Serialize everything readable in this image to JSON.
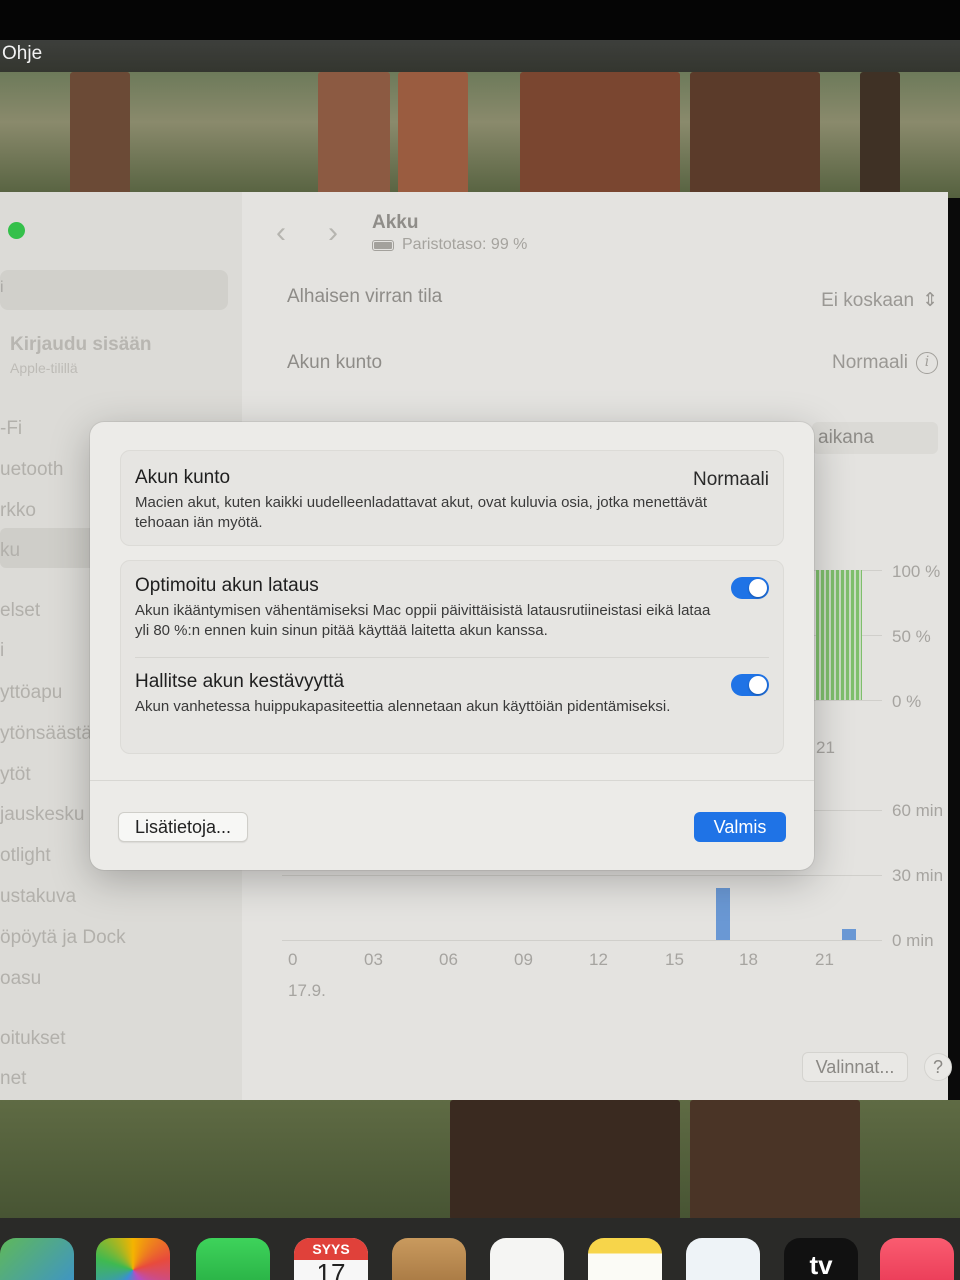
{
  "menubar": {
    "item": "Ohje"
  },
  "sidebar": {
    "search_partial": "i",
    "signin_title": "Kirjaudu sisään",
    "signin_sub": "Apple-tilillä",
    "items": [
      "-Fi",
      "uetooth",
      "rkko",
      "ku",
      "elset",
      "i",
      "yttöapu",
      "ytönsäästä",
      "ytöt",
      "jauskesku",
      "otlight",
      "ustakuva",
      "öpöytä ja Dock",
      "oasu",
      "oitukset",
      "net"
    ]
  },
  "header": {
    "title": "Akku",
    "battery_level": "Paristotaso: 99 %"
  },
  "rows": {
    "low_power_label": "Alhaisen virran tila",
    "low_power_value": "Ei koskaan",
    "health_label": "Akun kunto",
    "health_value": "Normaali",
    "period_partial": "aikana"
  },
  "chart": {
    "pct_ticks": [
      "100 %",
      "50 %",
      "0 %"
    ],
    "min_ticks": [
      "60 min",
      "30 min",
      "0 min"
    ],
    "hour_ticks": [
      "0",
      "03",
      "06",
      "09",
      "12",
      "15",
      "18",
      "21"
    ],
    "upper_partial_tick": "21",
    "date": "17.9."
  },
  "footer": {
    "options_label": "Valinnat...",
    "help_label": "?"
  },
  "sheet": {
    "health_title": "Akun kunto",
    "health_value": "Normaali",
    "health_desc": "Macien akut, kuten kaikki uudelleenladattavat akut, ovat kuluvia osia, jotka menettävät tehoaan iän myötä.",
    "optimized_title": "Optimoitu akun lataus",
    "optimized_desc": "Akun ikääntymisen vähentämiseksi Mac oppii päivittäisistä latausrutiineistasi eikä lataa yli 80 %:n ennen kuin sinun pitää käyttää laitetta akun kanssa.",
    "optimized_on": true,
    "manage_title": "Hallitse akun kestävyyttä",
    "manage_desc": "Akun vanhetessa huippukapasiteettia alennetaan akun käyttöiän pidentämiseksi.",
    "manage_on": true,
    "more_label": "Lisätietoja...",
    "done_label": "Valmis"
  },
  "dock": {
    "calendar_month": "SYYS",
    "calendar_day": "17",
    "tv_label": "tv",
    "icons": [
      "maps-icon",
      "photos-icon",
      "facetime-icon",
      "calendar-icon",
      "podcasts-icon",
      "reminders-icon",
      "notes-icon",
      "freeform-icon",
      "apple-tv-icon",
      "music-icon"
    ]
  },
  "colors": {
    "accent": "#1f73e6",
    "green_traffic": "#34c04a",
    "chart_green": "#7fbf6c",
    "chart_blue": "#6a98d4"
  }
}
